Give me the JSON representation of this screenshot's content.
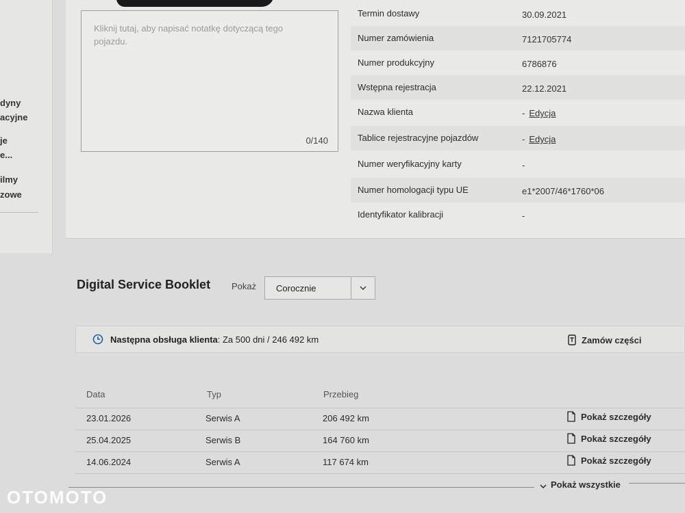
{
  "sidebar": {
    "fragments": [
      "dyny",
      "acyjne",
      "je",
      "e...",
      "ilmy",
      "zowe"
    ]
  },
  "note": {
    "placeholder": "Kliknij tutaj, aby napisać notatkę dotyczącą tego pojazdu.",
    "counter": "0/140"
  },
  "details": [
    {
      "label": "Termin dostawy",
      "value": "30.09.2021"
    },
    {
      "label": "Numer zamówienia",
      "value": "7121705774"
    },
    {
      "label": "Numer produkcyjny",
      "value": "6786876"
    },
    {
      "label": "Wstępna rejestracja",
      "value": "22.12.2021"
    },
    {
      "label": "Nazwa klienta",
      "value": "-",
      "edit": "Edycja"
    },
    {
      "label": "Tablice rejestracyjne pojazdów",
      "value": "-",
      "edit": "Edycja"
    },
    {
      "label": "Numer weryfikacyjny karty",
      "value": "-"
    },
    {
      "label": "Numer homologacji typu UE",
      "value": "e1*2007/46*1760*06"
    },
    {
      "label": "Identyfikator kalibracji",
      "value": "-"
    }
  ],
  "booklet": {
    "title": "Digital Service Booklet",
    "show_label": "Pokaż",
    "select_value": "Corocznie",
    "next_service_label": "Następna obsługa klienta",
    "next_service_value": ": Za 500 dni / 246 492 km",
    "order_parts": "Zamów części",
    "columns": [
      "Data",
      "Typ",
      "Przebieg"
    ],
    "rows": [
      {
        "date": "23.01.2026",
        "type": "Serwis A",
        "mileage": "206 492 km",
        "link": "Pokaż szczegóły"
      },
      {
        "date": "25.04.2025",
        "type": "Serwis B",
        "mileage": "164 760 km",
        "link": "Pokaż szczegóły"
      },
      {
        "date": "14.06.2024",
        "type": "Serwis A",
        "mileage": "117 674 km",
        "link": "Pokaż szczegóły"
      }
    ],
    "show_all": "Pokaż wszystkie"
  },
  "watermark": "OTOMOTO"
}
